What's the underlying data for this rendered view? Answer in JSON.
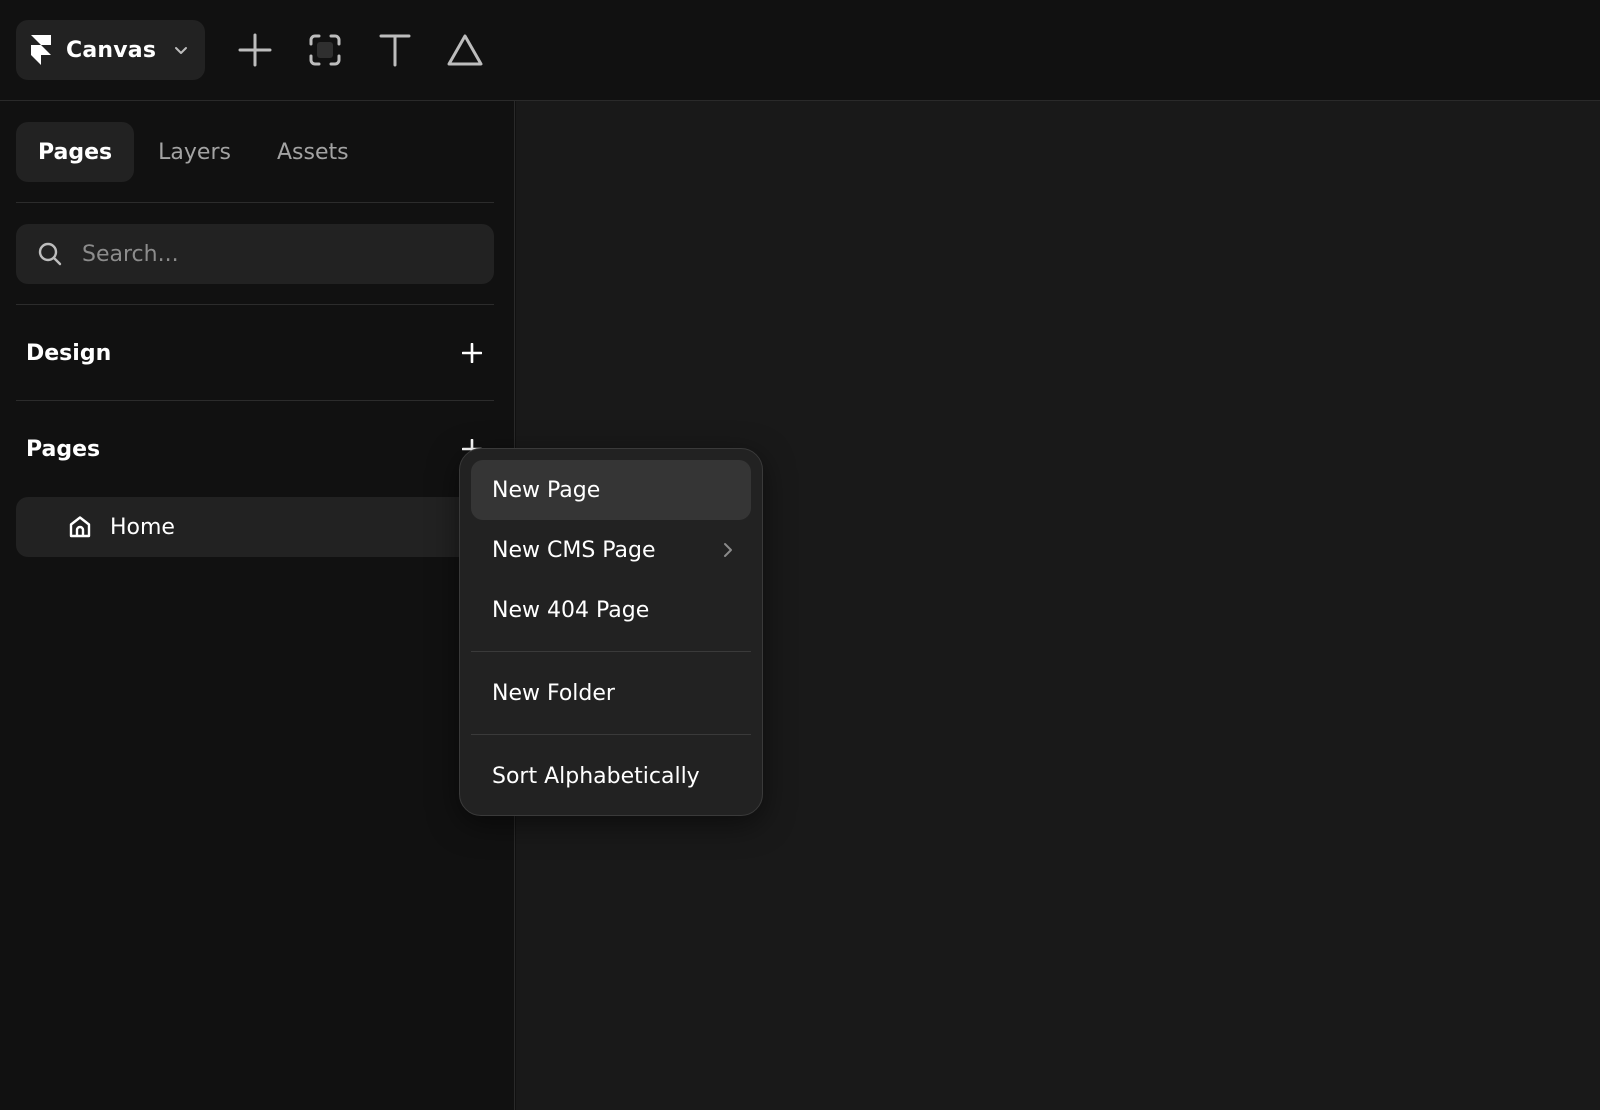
{
  "toolbar": {
    "project_name": "Canvas",
    "tools": [
      "add-icon",
      "frame-icon",
      "text-icon",
      "shape-icon"
    ]
  },
  "sidebar": {
    "tabs": [
      {
        "label": "Pages",
        "active": true
      },
      {
        "label": "Layers",
        "active": false
      },
      {
        "label": "Assets",
        "active": false
      }
    ],
    "search": {
      "placeholder": "Search...",
      "value": ""
    },
    "sections": {
      "design": {
        "label": "Design"
      },
      "pages": {
        "label": "Pages"
      }
    },
    "pages": [
      {
        "label": "Home",
        "icon": "home-icon"
      }
    ]
  },
  "context_menu": {
    "items": [
      {
        "label": "New Page",
        "highlighted": true
      },
      {
        "label": "New CMS Page",
        "has_submenu": true
      },
      {
        "label": "New 404 Page"
      },
      {
        "label": "New Folder"
      },
      {
        "label": "Sort Alphabetically"
      }
    ]
  },
  "colors": {
    "background": "#111111",
    "canvas": "#191919",
    "panel": "#222222",
    "menu_highlight": "#353535"
  }
}
